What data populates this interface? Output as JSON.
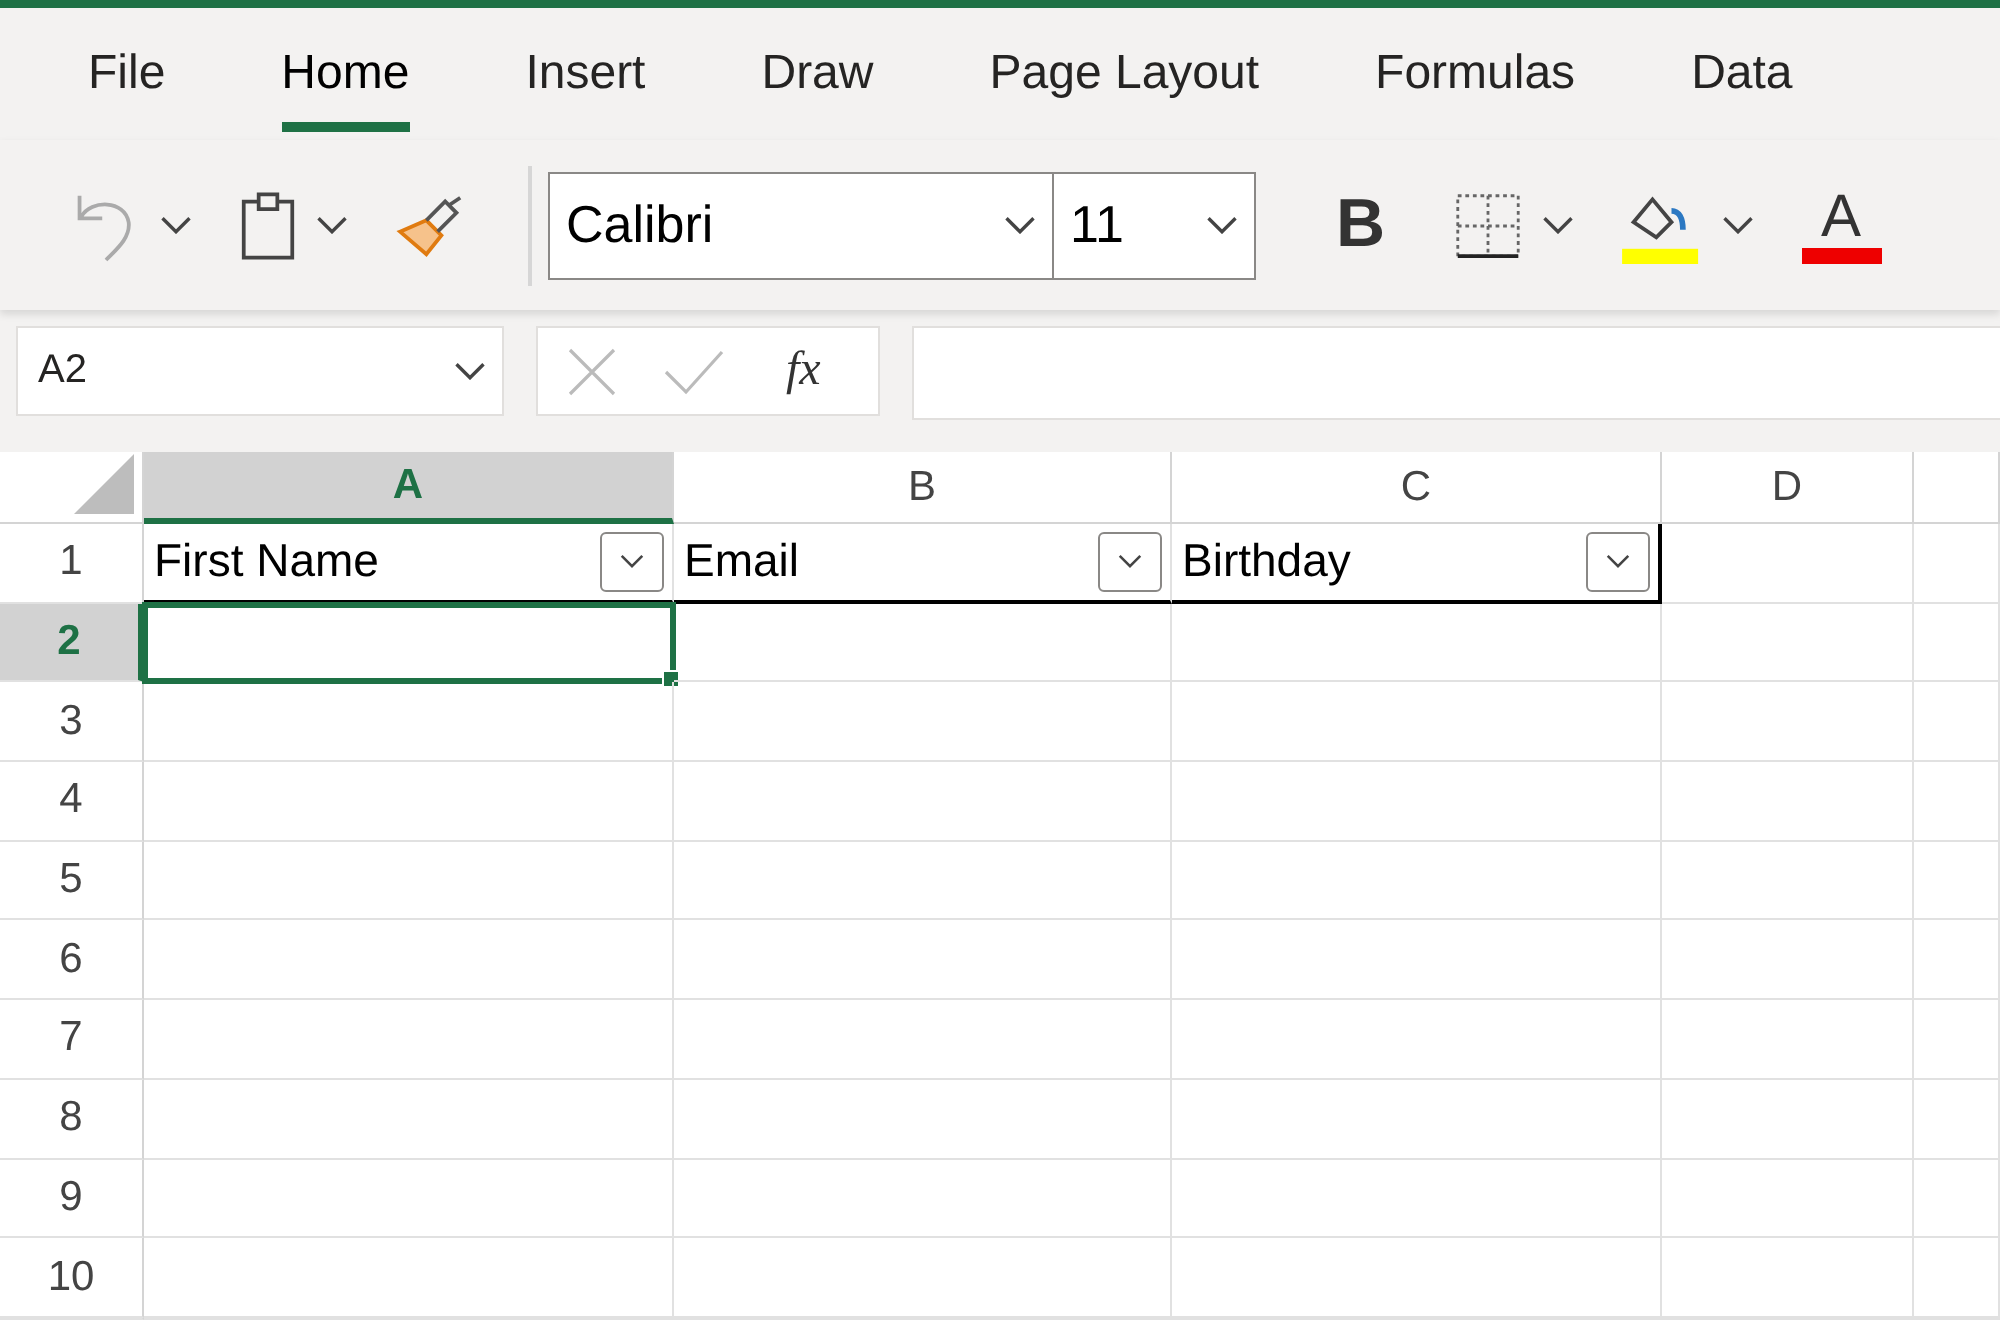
{
  "tabs": [
    {
      "label": "File",
      "selected": false
    },
    {
      "label": "Home",
      "selected": true
    },
    {
      "label": "Insert",
      "selected": false
    },
    {
      "label": "Draw",
      "selected": false
    },
    {
      "label": "Page Layout",
      "selected": false
    },
    {
      "label": "Formulas",
      "selected": false
    },
    {
      "label": "Data",
      "selected": false
    }
  ],
  "ribbon": {
    "font_name": "Calibri",
    "font_size": "11",
    "bold_label": "B",
    "font_color_label": "A"
  },
  "formula_bar": {
    "name_box": "A2",
    "function_label": "fx"
  },
  "sheet": {
    "columns": [
      {
        "label": "A",
        "selected": true
      },
      {
        "label": "B",
        "selected": false
      },
      {
        "label": "C",
        "selected": false
      },
      {
        "label": "D",
        "selected": false
      }
    ],
    "rows": [
      {
        "label": "1",
        "selected": false
      },
      {
        "label": "2",
        "selected": true
      },
      {
        "label": "3",
        "selected": false
      },
      {
        "label": "4",
        "selected": false
      },
      {
        "label": "5",
        "selected": false
      },
      {
        "label": "6",
        "selected": false
      },
      {
        "label": "7",
        "selected": false
      },
      {
        "label": "8",
        "selected": false
      },
      {
        "label": "9",
        "selected": false
      },
      {
        "label": "10",
        "selected": false
      }
    ],
    "table_headers": [
      "First Name",
      "Email",
      "Birthday"
    ]
  }
}
